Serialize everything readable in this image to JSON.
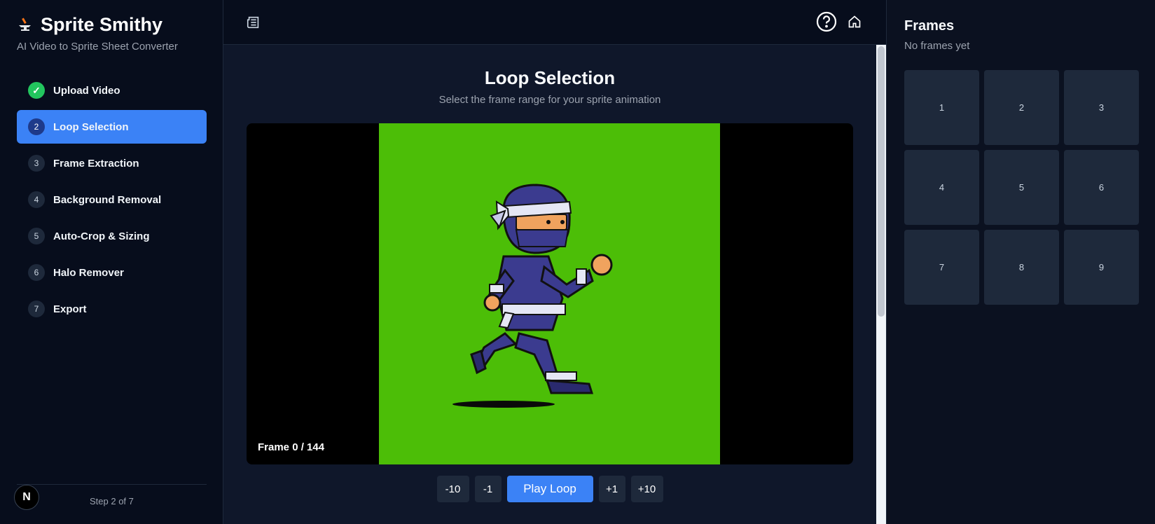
{
  "brand": {
    "title": "Sprite Smithy",
    "subtitle": "AI Video to Sprite Sheet Converter",
    "icon": "anvil-icon"
  },
  "steps": [
    {
      "num": "✓",
      "label": "Upload Video",
      "state": "done"
    },
    {
      "num": "2",
      "label": "Loop Selection",
      "state": "active"
    },
    {
      "num": "3",
      "label": "Frame Extraction",
      "state": "pending"
    },
    {
      "num": "4",
      "label": "Background Removal",
      "state": "pending"
    },
    {
      "num": "5",
      "label": "Auto-Crop & Sizing",
      "state": "pending"
    },
    {
      "num": "6",
      "label": "Halo Remover",
      "state": "pending"
    },
    {
      "num": "7",
      "label": "Export",
      "state": "pending"
    }
  ],
  "footer": {
    "badge": "N",
    "step_count": "Step 2 of 7"
  },
  "topbar": {
    "left_icon": "news-icon",
    "help_icon": "help-icon",
    "home_icon": "home-icon"
  },
  "main": {
    "title": "Loop Selection",
    "subtitle": "Select the frame range for your sprite animation",
    "frame_label": "Frame 0 / 144",
    "green_screen_color": "#4cbe07",
    "controls": {
      "back10": "-10",
      "back1": "-1",
      "play": "Play Loop",
      "fwd1": "+1",
      "fwd10": "+10"
    }
  },
  "frames_panel": {
    "title": "Frames",
    "subtitle": "No frames yet",
    "slots": [
      "1",
      "2",
      "3",
      "4",
      "5",
      "6",
      "7",
      "8",
      "9"
    ]
  },
  "colors": {
    "accent": "#3b82f6",
    "success": "#22c55e",
    "background": "#0f172a"
  }
}
